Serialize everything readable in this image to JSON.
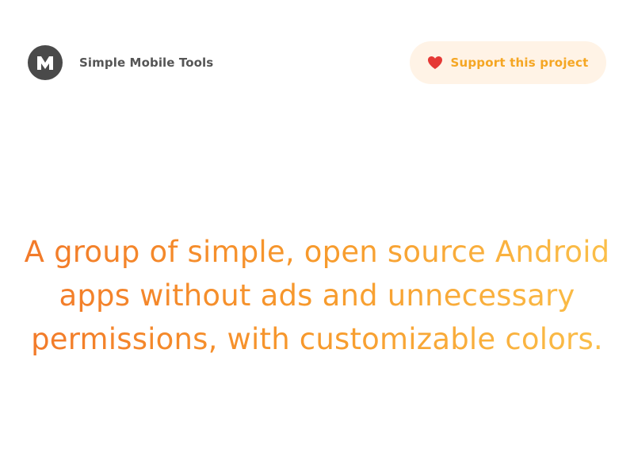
{
  "header": {
    "brand_name": "Simple Mobile Tools",
    "logo_letter": "M",
    "logo_color": "#4a4a4a",
    "support_label": "Support this project",
    "support_icon": "heart-icon",
    "support_color": "#f5a623",
    "support_bg": "#fff3e6"
  },
  "hero": {
    "text": "A group of simple, open source Android apps without ads and unnecessary permissions, with customizable colors.",
    "gradient_start": "#f2792a",
    "gradient_end": "#fbc04a"
  }
}
